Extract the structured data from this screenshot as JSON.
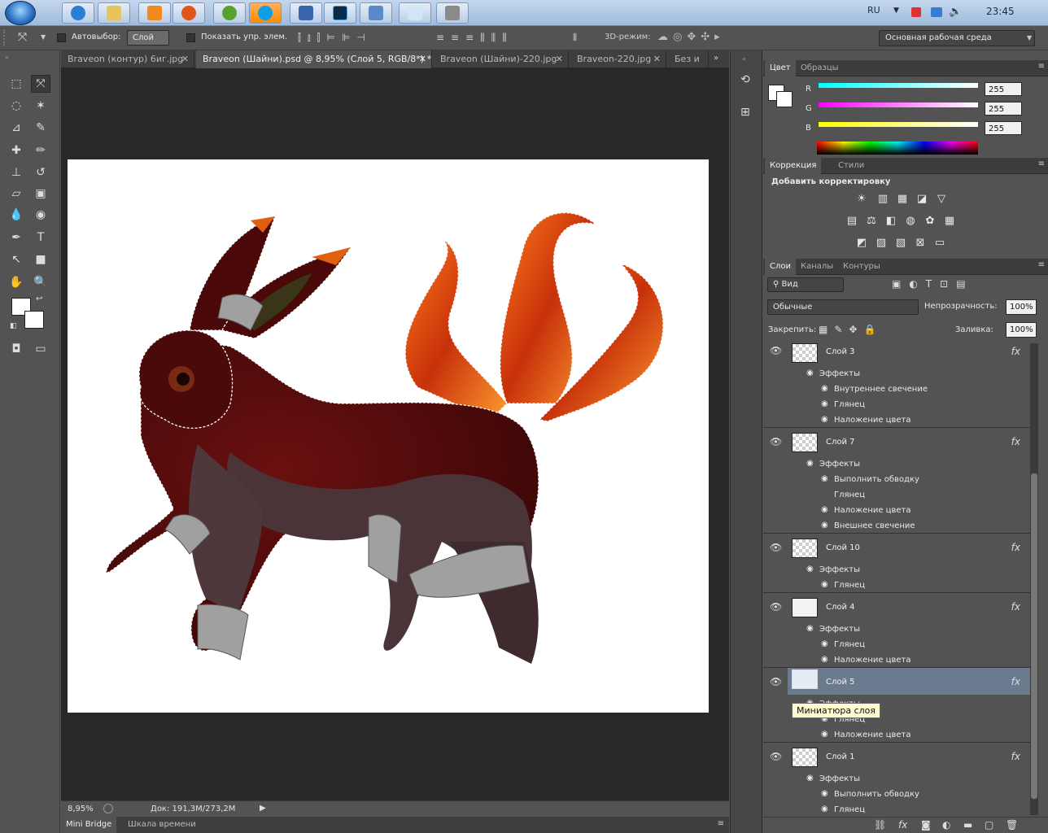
{
  "taskbar": {
    "apps": [
      "ie-icon",
      "explorer-icon",
      "media-icon",
      "firefox-icon",
      "utorrent-icon",
      "skype-icon",
      "app-icon",
      "photoshop-icon",
      "window-icon",
      "notepad-icon",
      "doc-icon"
    ],
    "lang": "RU",
    "time": "23:45"
  },
  "options": {
    "autoselect_label": "Автовыбор:",
    "autoselect_value": "Слой",
    "show_transform_label": "Показать упр. элем.",
    "mode3d_label": "3D-режим:",
    "workspace": "Основная рабочая среда"
  },
  "doc_tabs": [
    "Braveon (контур) 6иг.jpg",
    "Braveon (Шайни).psd @ 8,95% (Слой 5, RGB/8*) *",
    "Braveon (Шайни)-220.jpg",
    "Braveon-220.jpg",
    "Без и"
  ],
  "status": {
    "zoom": "8,95%",
    "doc": "Док: 191,3M/273,2M"
  },
  "bottom_tabs": [
    "Mini Bridge",
    "Шкала времени"
  ],
  "color_panel": {
    "tabs": [
      "Цвет",
      "Образцы"
    ],
    "channels": [
      {
        "label": "R",
        "value": "255",
        "color": "#00e5ff"
      },
      {
        "label": "G",
        "value": "255",
        "color": "#e030e0"
      },
      {
        "label": "B",
        "value": "255",
        "color": "#f0f000"
      }
    ]
  },
  "adjust_panel": {
    "tabs": [
      "Коррекция",
      "Стили"
    ],
    "title": "Добавить корректировку"
  },
  "layers_panel": {
    "tabs": [
      "Слои",
      "Каналы",
      "Контуры"
    ],
    "filter": "Вид",
    "blend": "Обычные",
    "opacity_label": "Непрозрачность:",
    "opacity": "100%",
    "lock_label": "Закрепить:",
    "fill_label": "Заливка:",
    "fill": "100%",
    "layers": [
      {
        "name": "Слой 3",
        "effects_label": "Эффекты",
        "effects": [
          "Внутреннее свечение",
          "Глянец",
          "Наложение цвета"
        ]
      },
      {
        "name": "Слой 7",
        "effects_label": "Эффекты",
        "effects": [
          "Выполнить обводку",
          "Глянец",
          "Наложение цвета",
          "Внешнее свечение"
        ]
      },
      {
        "name": "Слой 10",
        "effects_label": "Эффекты",
        "effects": [
          "Глянец"
        ]
      },
      {
        "name": "Слой 4",
        "effects_label": "Эффекты",
        "effects": [
          "Глянец",
          "Наложение цвета"
        ]
      },
      {
        "name": "Слой 5",
        "effects_label": "Эффекты",
        "effects": [
          "Глянец",
          "Наложение цвета"
        ]
      },
      {
        "name": "Слой 1",
        "effects_label": "Эффекты",
        "effects": [
          "Выполнить обводку",
          "Глянец"
        ]
      }
    ],
    "tooltip": "Миниатюра слоя"
  }
}
